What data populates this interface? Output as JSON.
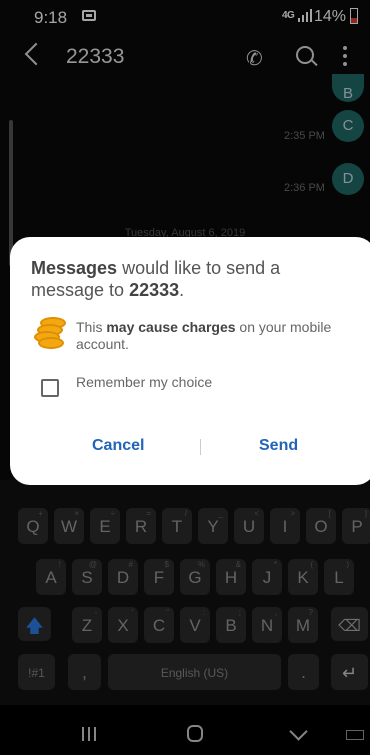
{
  "status_bar": {
    "time": "9:18",
    "network": "4G",
    "battery": "14%"
  },
  "app_bar": {
    "contact": "22333"
  },
  "conversation": {
    "bubbles": [
      "B",
      "C",
      "D"
    ],
    "timestamps": [
      "2:35 PM",
      "2:36 PM"
    ],
    "date_separator": "Tuesday, August 6, 2019"
  },
  "dialog": {
    "app_name": "Messages",
    "text_mid": " would like to send a message to ",
    "number": "22333",
    "text_end": ".",
    "warn_pre": "This ",
    "warn_bold": "may cause charges",
    "warn_post": " on your mobile account.",
    "remember_label": "Remember my choice",
    "cancel_label": "Cancel",
    "send_label": "Send"
  },
  "keyboard": {
    "row1": [
      "Q",
      "W",
      "E",
      "R",
      "T",
      "Y",
      "U",
      "I",
      "O",
      "P"
    ],
    "row1_hints": [
      "+",
      "×",
      "÷",
      "=",
      "/",
      "_",
      "<",
      ">",
      "[",
      "]"
    ],
    "row2": [
      "A",
      "S",
      "D",
      "F",
      "G",
      "H",
      "J",
      "K",
      "L"
    ],
    "row2_hints": [
      "!",
      "@",
      "#",
      "$",
      "%",
      "&",
      "*",
      "(",
      ")"
    ],
    "row3": [
      "Z",
      "X",
      "C",
      "V",
      "B",
      "N",
      "M"
    ],
    "row3_hints": [
      "-",
      "'",
      "\"",
      ":",
      ";",
      ",",
      "?"
    ],
    "symbols_label": "!#1",
    "comma_label": ",",
    "space_label": "English (US)",
    "period_label": "."
  },
  "colors": {
    "accent": "#2264b8",
    "bubble": "#1f6b67",
    "coin": "#f2a813"
  }
}
